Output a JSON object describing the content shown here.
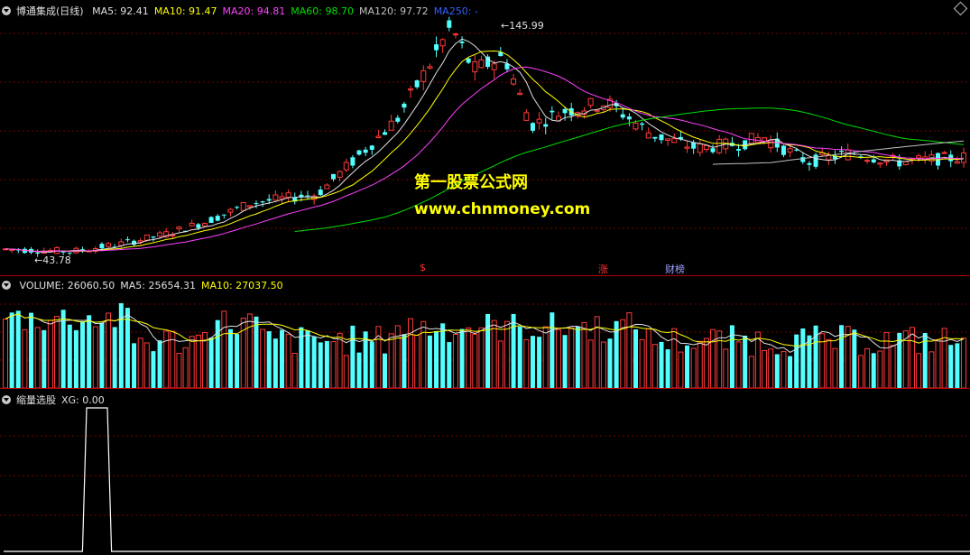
{
  "stock_name": "博通集成(日线)",
  "price_ma": [
    {
      "label": "MA5: 92.41",
      "color": "#e0e0e0"
    },
    {
      "label": "MA10: 91.47",
      "color": "#ffff00"
    },
    {
      "label": "MA20: 94.81",
      "color": "#ff40ff"
    },
    {
      "label": "MA60: 98.70",
      "color": "#00e000"
    },
    {
      "label": "MA120: 97.72",
      "color": "#c0c0c0"
    },
    {
      "label": "MA250: -",
      "color": "#3060ff"
    }
  ],
  "high_label": "145.99",
  "low_label": "43.78",
  "event_marks": [
    {
      "text": "$",
      "color": "#ff3030"
    },
    {
      "text": "涨",
      "color": "#ff3030"
    },
    {
      "text": "财榜",
      "color": "#a0a0ff"
    }
  ],
  "watermark": {
    "cn": "第一股票公式网",
    "url": "www.chnmoney.com"
  },
  "volume_header": [
    {
      "label": "VOLUME: 26060.50",
      "color": "#e0e0e0"
    },
    {
      "label": "MA5: 25654.31",
      "color": "#e0e0e0"
    },
    {
      "label": "MA10: 27037.50",
      "color": "#ffff00"
    }
  ],
  "indicator_header": {
    "name": "缩量选股",
    "value": "XG: 0.00"
  },
  "colors": {
    "up": "#ff3a3a",
    "down": "#54ffff",
    "grid": "#800000",
    "separator": "#b00000"
  },
  "chart_data": {
    "type": "candlestick",
    "price_high": 145.99,
    "price_low": 43.78,
    "xg_signal": [
      0,
      0,
      0,
      0,
      0,
      0,
      0,
      0,
      0,
      0,
      0,
      0,
      0,
      0,
      0,
      0,
      0,
      0,
      0,
      0,
      1,
      1,
      1,
      1,
      1,
      1,
      0,
      0,
      0,
      0
    ]
  }
}
